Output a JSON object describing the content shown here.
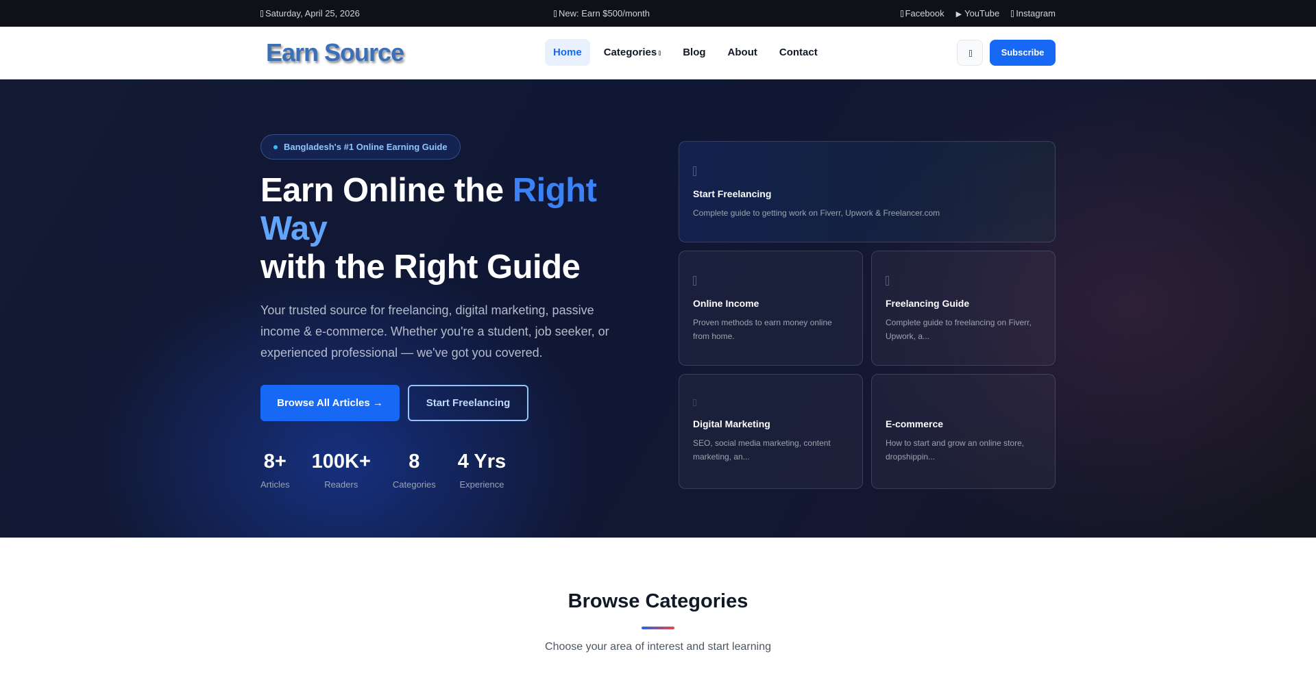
{
  "topbar": {
    "date": "Saturday, April 25, 2026",
    "ticker": "New: Earn $500/month",
    "social": [
      {
        "label": "Facebook",
        "icon": "facebook-icon"
      },
      {
        "label": "YouTube",
        "icon": "play-icon"
      },
      {
        "label": "Instagram",
        "icon": "instagram-icon"
      }
    ]
  },
  "nav": {
    "logo": "Earn Source",
    "items": [
      {
        "label": "Home",
        "active": true
      },
      {
        "label": "Categories"
      },
      {
        "label": "Blog"
      },
      {
        "label": "About"
      },
      {
        "label": "Contact"
      }
    ],
    "subscribe": "Subscribe"
  },
  "hero": {
    "badge": "Bangladesh's #1 Online Earning Guide",
    "title_part1": "Earn Online the ",
    "title_highlight1": "Right",
    "title_highlight2": "Way",
    "title_part2": "with the Right Guide",
    "lead": "Your trusted source for freelancing, digital marketing, passive income & e-commerce. Whether you're a student, job seeker, or experienced professional — we've got you covered.",
    "btn_primary": "Browse All Articles →",
    "btn_outline": "Start Freelancing",
    "stats": [
      {
        "value": "8+",
        "label": "Articles"
      },
      {
        "value": "100K+",
        "label": "Readers"
      },
      {
        "value": "8",
        "label": "Categories"
      },
      {
        "value": "4 Yrs",
        "label": "Experience"
      }
    ],
    "cards": [
      {
        "title": "Start Freelancing",
        "desc": "Complete guide to getting work on Fiverr, Upwork & Freelancer.com"
      },
      {
        "title": "Online Income",
        "desc": "Proven methods to earn money online from home."
      },
      {
        "title": "Freelancing Guide",
        "desc": "Complete guide to freelancing on Fiverr, Upwork, a..."
      },
      {
        "title": "Digital Marketing",
        "desc": "SEO, social media marketing, content marketing, an..."
      },
      {
        "title": "E-commerce",
        "desc": "How to start and grow an online store, dropshippin..."
      }
    ]
  },
  "categories": {
    "title": "Browse Categories",
    "subtitle": "Choose your area of interest and start learning"
  },
  "colors": {
    "accent": "#1769f5",
    "hero_bg": "#121833",
    "topbar_bg": "#0f1117"
  }
}
